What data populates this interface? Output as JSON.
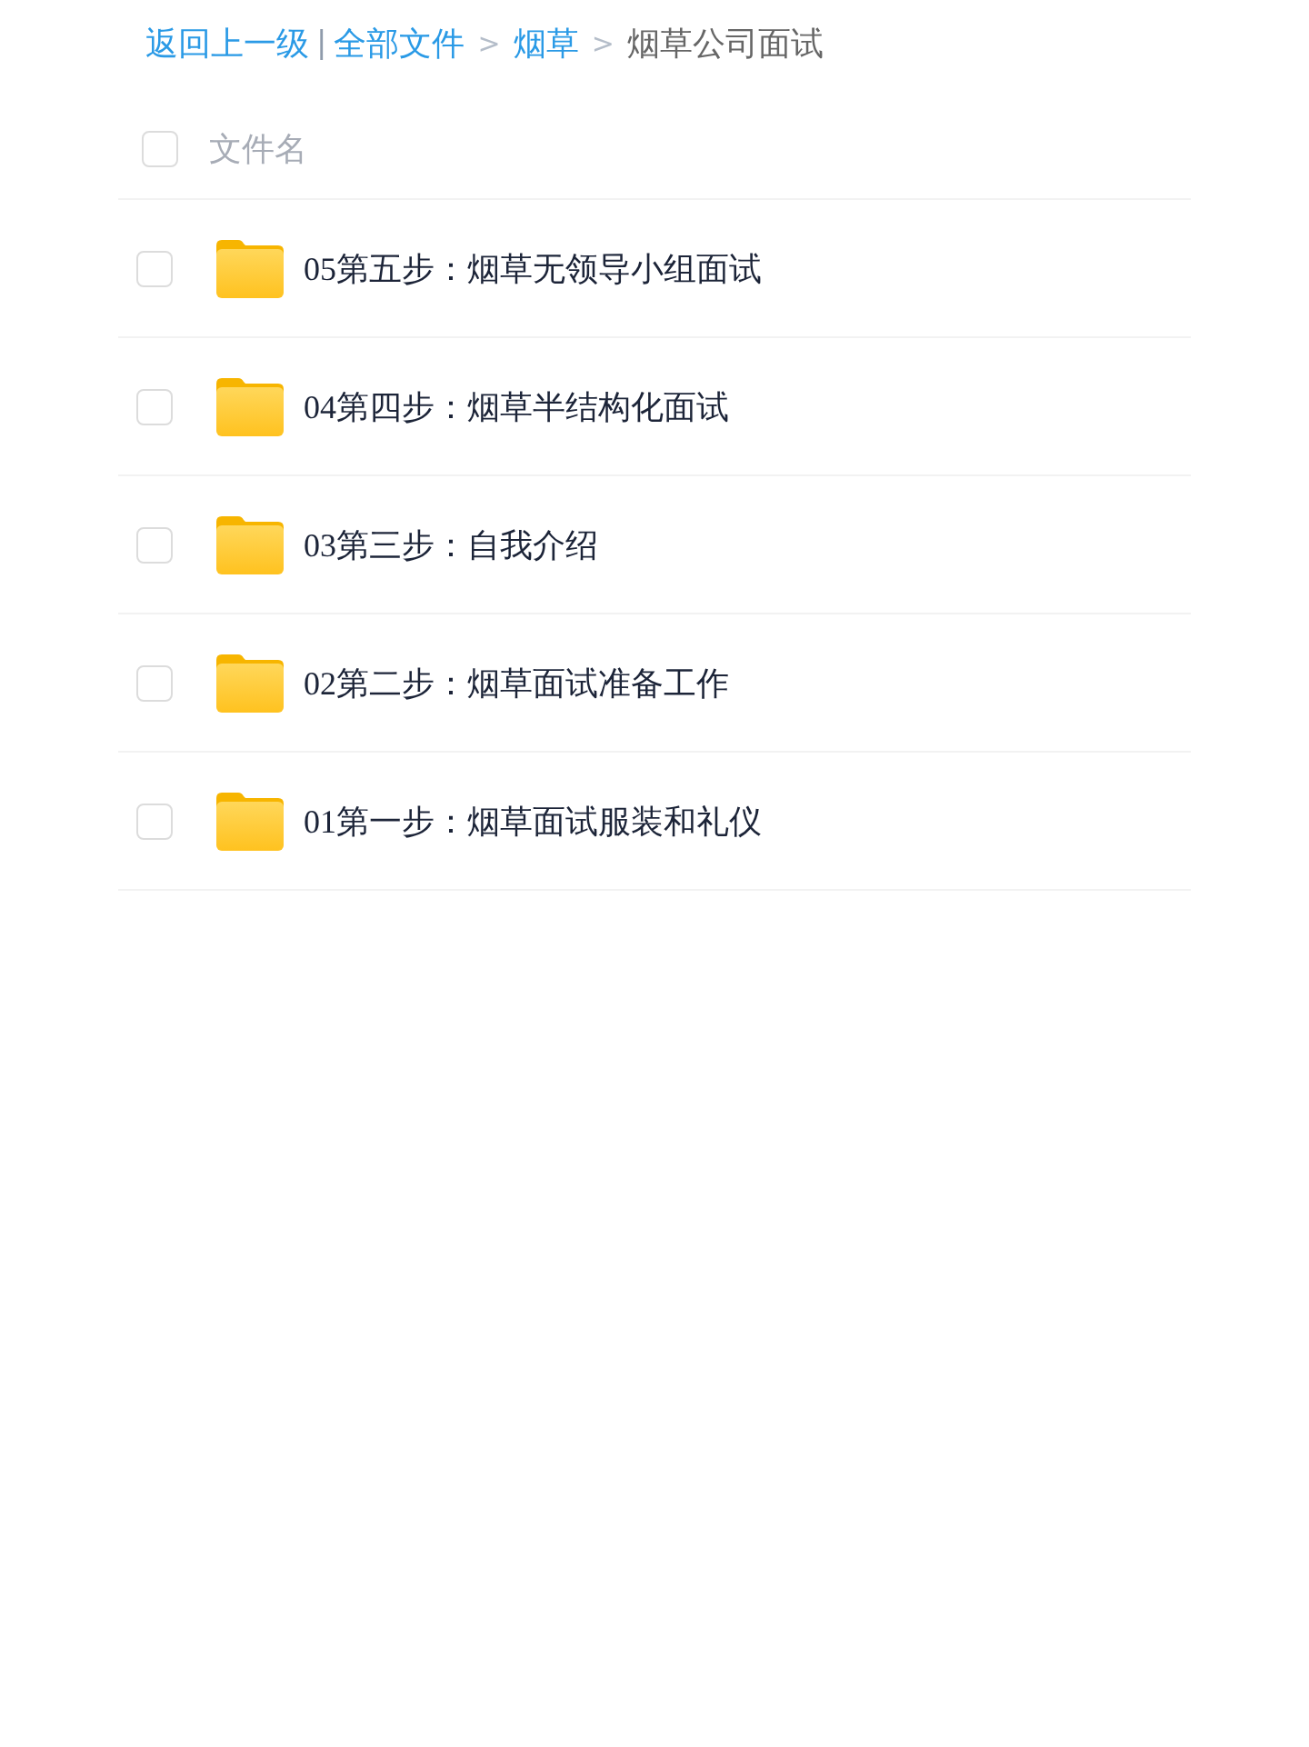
{
  "breadcrumb": {
    "back": "返回上一级",
    "divider": "|",
    "crumbs": [
      {
        "kind": "link",
        "label": "全部文件"
      },
      {
        "kind": "link",
        "arrow": ">",
        "label": "烟草"
      },
      {
        "kind": "current",
        "arrow": ">",
        "label": "烟草公司面试"
      }
    ]
  },
  "list_header": {
    "checked": false,
    "label": "文件名"
  },
  "files": [
    {
      "kind": "folder",
      "name": "05第五步：烟草无领导小组面试",
      "checked": false
    },
    {
      "kind": "folder",
      "name": "04第四步：烟草半结构化面试",
      "checked": false
    },
    {
      "kind": "folder",
      "name": "03第三步：自我介绍",
      "checked": false
    },
    {
      "kind": "folder",
      "name": "02第二步：烟草面试准备工作",
      "checked": false
    },
    {
      "kind": "folder",
      "name": "01第一步：烟草面试服装和礼仪",
      "checked": false
    }
  ]
}
